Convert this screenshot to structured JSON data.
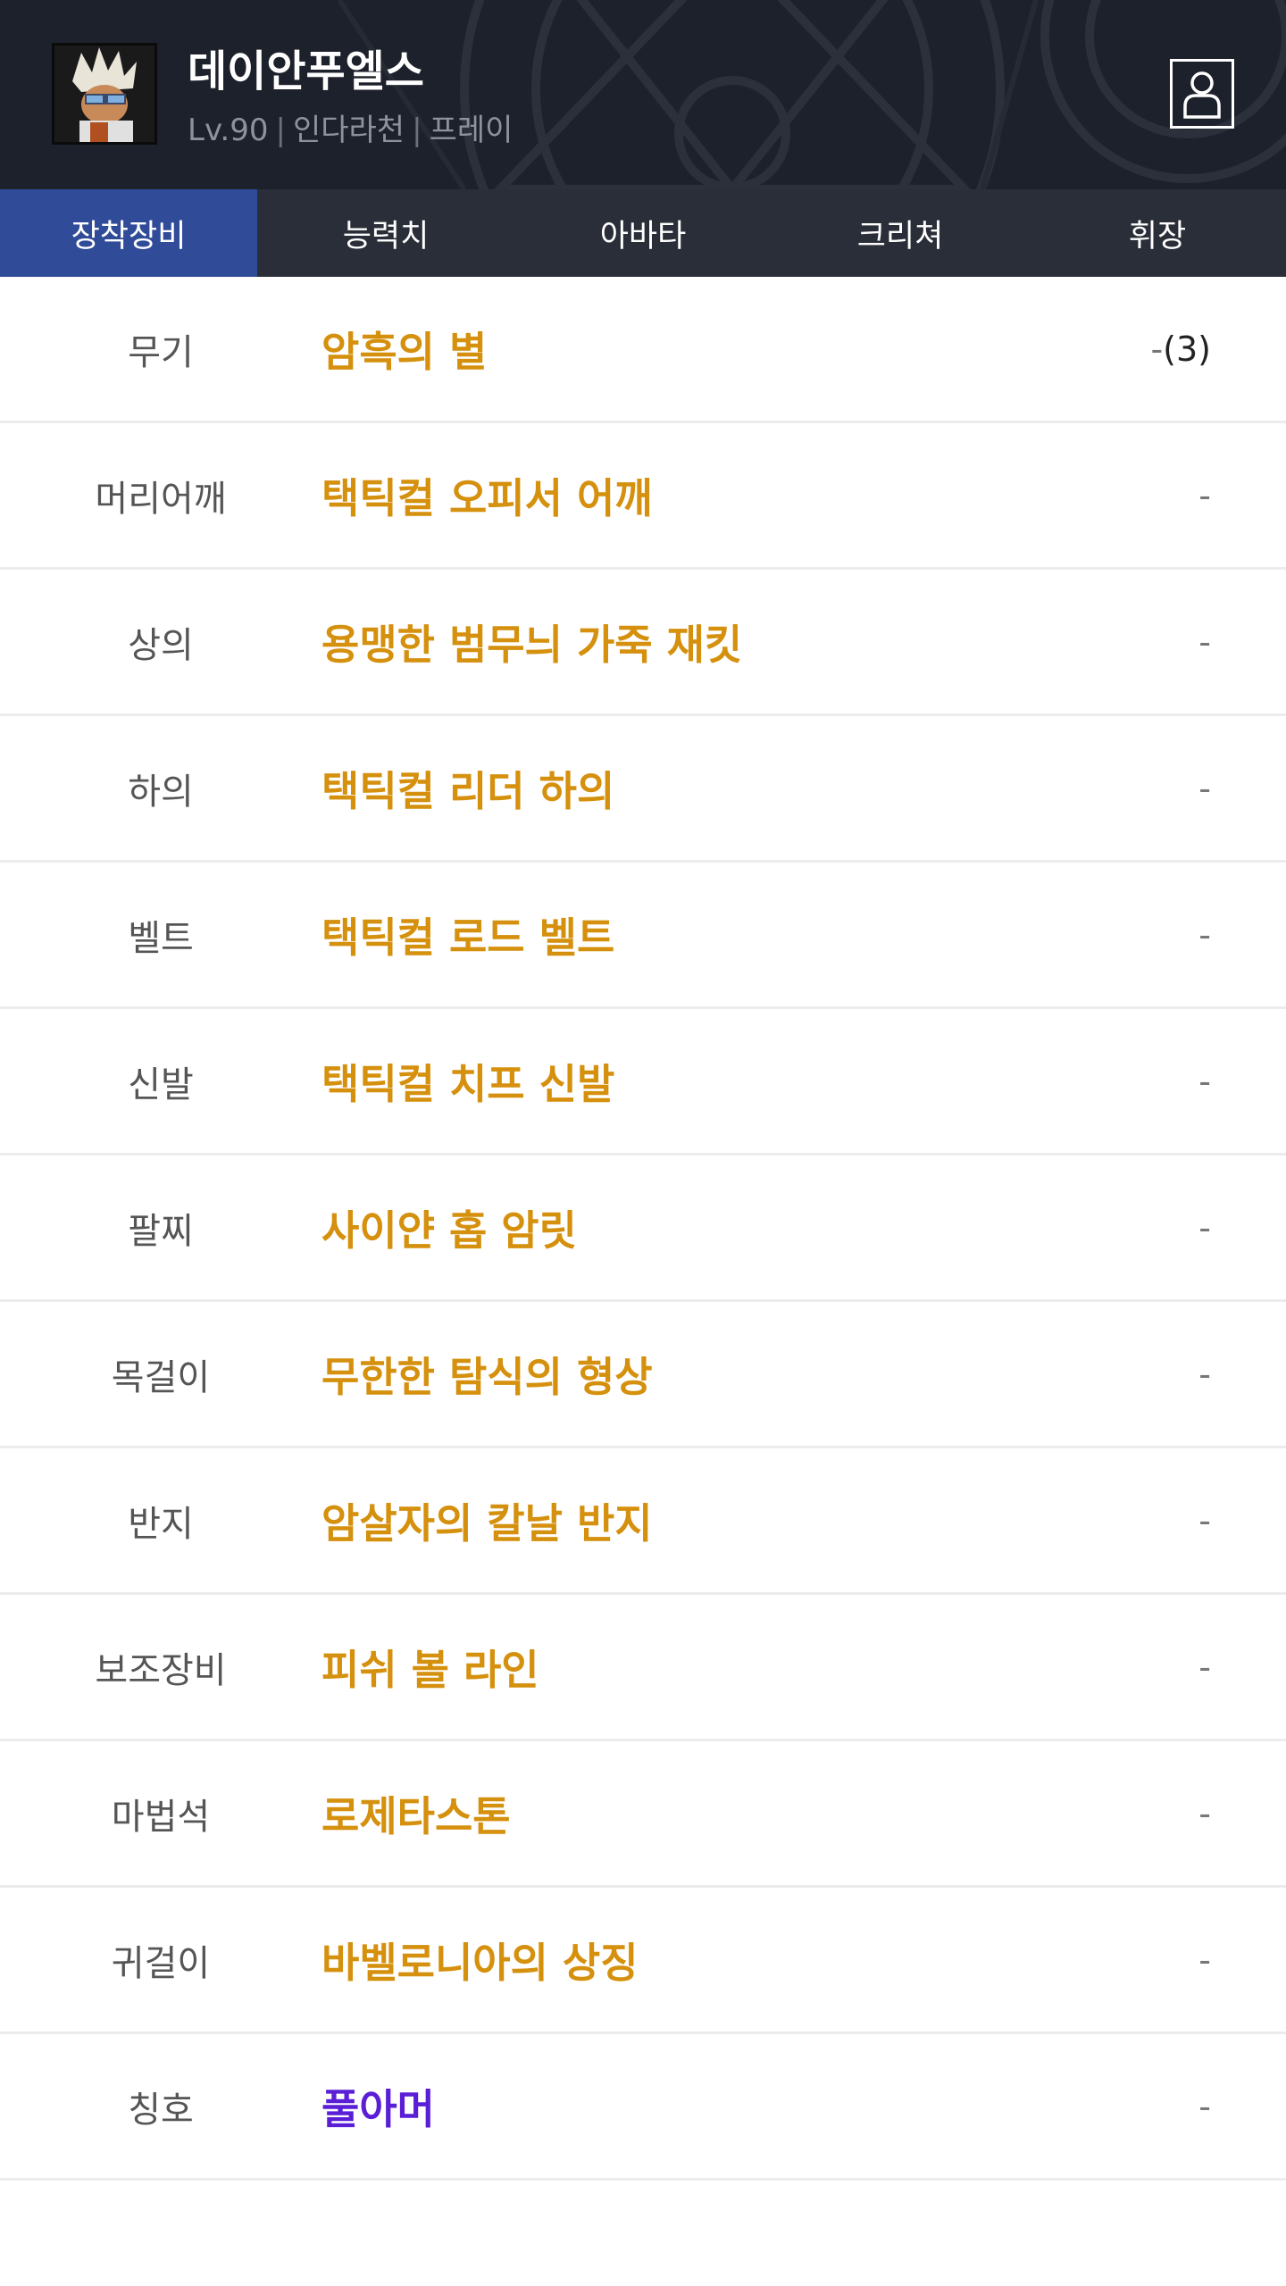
{
  "colors": {
    "header_bg": "#1d212b",
    "tab_bar_bg": "#2a2e38",
    "tab_active_bg": "#304c99",
    "item_gold": "#d5900d",
    "item_purple": "#5a1ed6"
  },
  "character": {
    "name": "데이안푸엘스",
    "level": "Lv.90",
    "server": "인다라천",
    "job": "프레이",
    "separator": "|",
    "profile_icon": "person-outline-icon"
  },
  "tabs": [
    {
      "label": "장착장비",
      "active": true
    },
    {
      "label": "능력치",
      "active": false
    },
    {
      "label": "아바타",
      "active": false
    },
    {
      "label": "크리쳐",
      "active": false
    },
    {
      "label": "휘장",
      "active": false
    }
  ],
  "equipment": [
    {
      "slot": "무기",
      "item": "암흑의 별",
      "value": "-",
      "extra": "(3)",
      "color": "gold"
    },
    {
      "slot": "머리어깨",
      "item": "택틱컬 오피서 어깨",
      "value": "-",
      "extra": "",
      "color": "gold"
    },
    {
      "slot": "상의",
      "item": "용맹한 범무늬 가죽 재킷",
      "value": "-",
      "extra": "",
      "color": "gold"
    },
    {
      "slot": "하의",
      "item": "택틱컬 리더 하의",
      "value": "-",
      "extra": "",
      "color": "gold"
    },
    {
      "slot": "벨트",
      "item": "택틱컬 로드 벨트",
      "value": "-",
      "extra": "",
      "color": "gold"
    },
    {
      "slot": "신발",
      "item": "택틱컬 치프 신발",
      "value": "-",
      "extra": "",
      "color": "gold"
    },
    {
      "slot": "팔찌",
      "item": "사이얀 홉 암릿",
      "value": "-",
      "extra": "",
      "color": "gold"
    },
    {
      "slot": "목걸이",
      "item": "무한한 탐식의 형상",
      "value": "-",
      "extra": "",
      "color": "gold"
    },
    {
      "slot": "반지",
      "item": "암살자의 칼날 반지",
      "value": "-",
      "extra": "",
      "color": "gold"
    },
    {
      "slot": "보조장비",
      "item": "피쉬 볼 라인",
      "value": "-",
      "extra": "",
      "color": "gold"
    },
    {
      "slot": "마법석",
      "item": "로제타스톤",
      "value": "-",
      "extra": "",
      "color": "gold"
    },
    {
      "slot": "귀걸이",
      "item": "바벨로니아의 상징",
      "value": "-",
      "extra": "",
      "color": "gold"
    },
    {
      "slot": "칭호",
      "item": "풀아머",
      "value": "-",
      "extra": "",
      "color": "purple"
    }
  ]
}
